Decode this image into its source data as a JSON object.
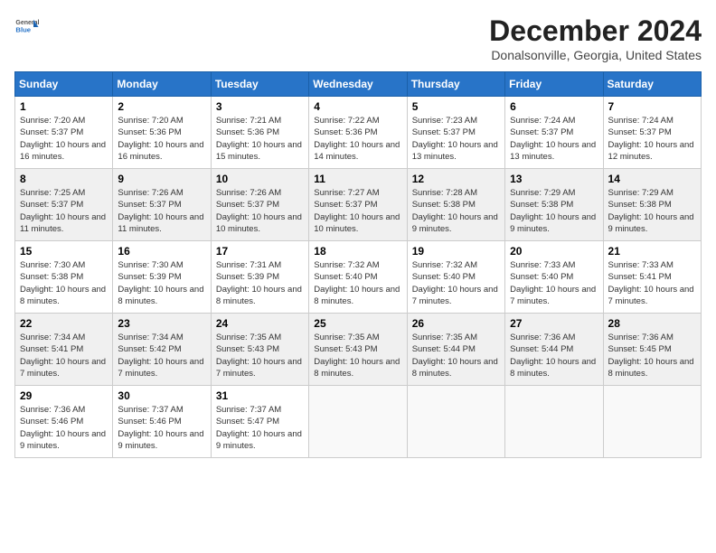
{
  "header": {
    "logo": {
      "general": "General",
      "blue": "Blue"
    },
    "title": "December 2024",
    "location": "Donalsonville, Georgia, United States"
  },
  "days_of_week": [
    "Sunday",
    "Monday",
    "Tuesday",
    "Wednesday",
    "Thursday",
    "Friday",
    "Saturday"
  ],
  "weeks": [
    [
      {
        "day": "1",
        "sunrise": "7:20 AM",
        "sunset": "5:37 PM",
        "daylight": "10 hours and 16 minutes."
      },
      {
        "day": "2",
        "sunrise": "7:20 AM",
        "sunset": "5:36 PM",
        "daylight": "10 hours and 16 minutes."
      },
      {
        "day": "3",
        "sunrise": "7:21 AM",
        "sunset": "5:36 PM",
        "daylight": "10 hours and 15 minutes."
      },
      {
        "day": "4",
        "sunrise": "7:22 AM",
        "sunset": "5:36 PM",
        "daylight": "10 hours and 14 minutes."
      },
      {
        "day": "5",
        "sunrise": "7:23 AM",
        "sunset": "5:37 PM",
        "daylight": "10 hours and 13 minutes."
      },
      {
        "day": "6",
        "sunrise": "7:24 AM",
        "sunset": "5:37 PM",
        "daylight": "10 hours and 13 minutes."
      },
      {
        "day": "7",
        "sunrise": "7:24 AM",
        "sunset": "5:37 PM",
        "daylight": "10 hours and 12 minutes."
      }
    ],
    [
      {
        "day": "8",
        "sunrise": "7:25 AM",
        "sunset": "5:37 PM",
        "daylight": "10 hours and 11 minutes."
      },
      {
        "day": "9",
        "sunrise": "7:26 AM",
        "sunset": "5:37 PM",
        "daylight": "10 hours and 11 minutes."
      },
      {
        "day": "10",
        "sunrise": "7:26 AM",
        "sunset": "5:37 PM",
        "daylight": "10 hours and 10 minutes."
      },
      {
        "day": "11",
        "sunrise": "7:27 AM",
        "sunset": "5:37 PM",
        "daylight": "10 hours and 10 minutes."
      },
      {
        "day": "12",
        "sunrise": "7:28 AM",
        "sunset": "5:38 PM",
        "daylight": "10 hours and 9 minutes."
      },
      {
        "day": "13",
        "sunrise": "7:29 AM",
        "sunset": "5:38 PM",
        "daylight": "10 hours and 9 minutes."
      },
      {
        "day": "14",
        "sunrise": "7:29 AM",
        "sunset": "5:38 PM",
        "daylight": "10 hours and 9 minutes."
      }
    ],
    [
      {
        "day": "15",
        "sunrise": "7:30 AM",
        "sunset": "5:38 PM",
        "daylight": "10 hours and 8 minutes."
      },
      {
        "day": "16",
        "sunrise": "7:30 AM",
        "sunset": "5:39 PM",
        "daylight": "10 hours and 8 minutes."
      },
      {
        "day": "17",
        "sunrise": "7:31 AM",
        "sunset": "5:39 PM",
        "daylight": "10 hours and 8 minutes."
      },
      {
        "day": "18",
        "sunrise": "7:32 AM",
        "sunset": "5:40 PM",
        "daylight": "10 hours and 8 minutes."
      },
      {
        "day": "19",
        "sunrise": "7:32 AM",
        "sunset": "5:40 PM",
        "daylight": "10 hours and 7 minutes."
      },
      {
        "day": "20",
        "sunrise": "7:33 AM",
        "sunset": "5:40 PM",
        "daylight": "10 hours and 7 minutes."
      },
      {
        "day": "21",
        "sunrise": "7:33 AM",
        "sunset": "5:41 PM",
        "daylight": "10 hours and 7 minutes."
      }
    ],
    [
      {
        "day": "22",
        "sunrise": "7:34 AM",
        "sunset": "5:41 PM",
        "daylight": "10 hours and 7 minutes."
      },
      {
        "day": "23",
        "sunrise": "7:34 AM",
        "sunset": "5:42 PM",
        "daylight": "10 hours and 7 minutes."
      },
      {
        "day": "24",
        "sunrise": "7:35 AM",
        "sunset": "5:43 PM",
        "daylight": "10 hours and 7 minutes."
      },
      {
        "day": "25",
        "sunrise": "7:35 AM",
        "sunset": "5:43 PM",
        "daylight": "10 hours and 8 minutes."
      },
      {
        "day": "26",
        "sunrise": "7:35 AM",
        "sunset": "5:44 PM",
        "daylight": "10 hours and 8 minutes."
      },
      {
        "day": "27",
        "sunrise": "7:36 AM",
        "sunset": "5:44 PM",
        "daylight": "10 hours and 8 minutes."
      },
      {
        "day": "28",
        "sunrise": "7:36 AM",
        "sunset": "5:45 PM",
        "daylight": "10 hours and 8 minutes."
      }
    ],
    [
      {
        "day": "29",
        "sunrise": "7:36 AM",
        "sunset": "5:46 PM",
        "daylight": "10 hours and 9 minutes."
      },
      {
        "day": "30",
        "sunrise": "7:37 AM",
        "sunset": "5:46 PM",
        "daylight": "10 hours and 9 minutes."
      },
      {
        "day": "31",
        "sunrise": "7:37 AM",
        "sunset": "5:47 PM",
        "daylight": "10 hours and 9 minutes."
      },
      null,
      null,
      null,
      null
    ]
  ],
  "labels": {
    "sunrise": "Sunrise:",
    "sunset": "Sunset:",
    "daylight": "Daylight:"
  }
}
